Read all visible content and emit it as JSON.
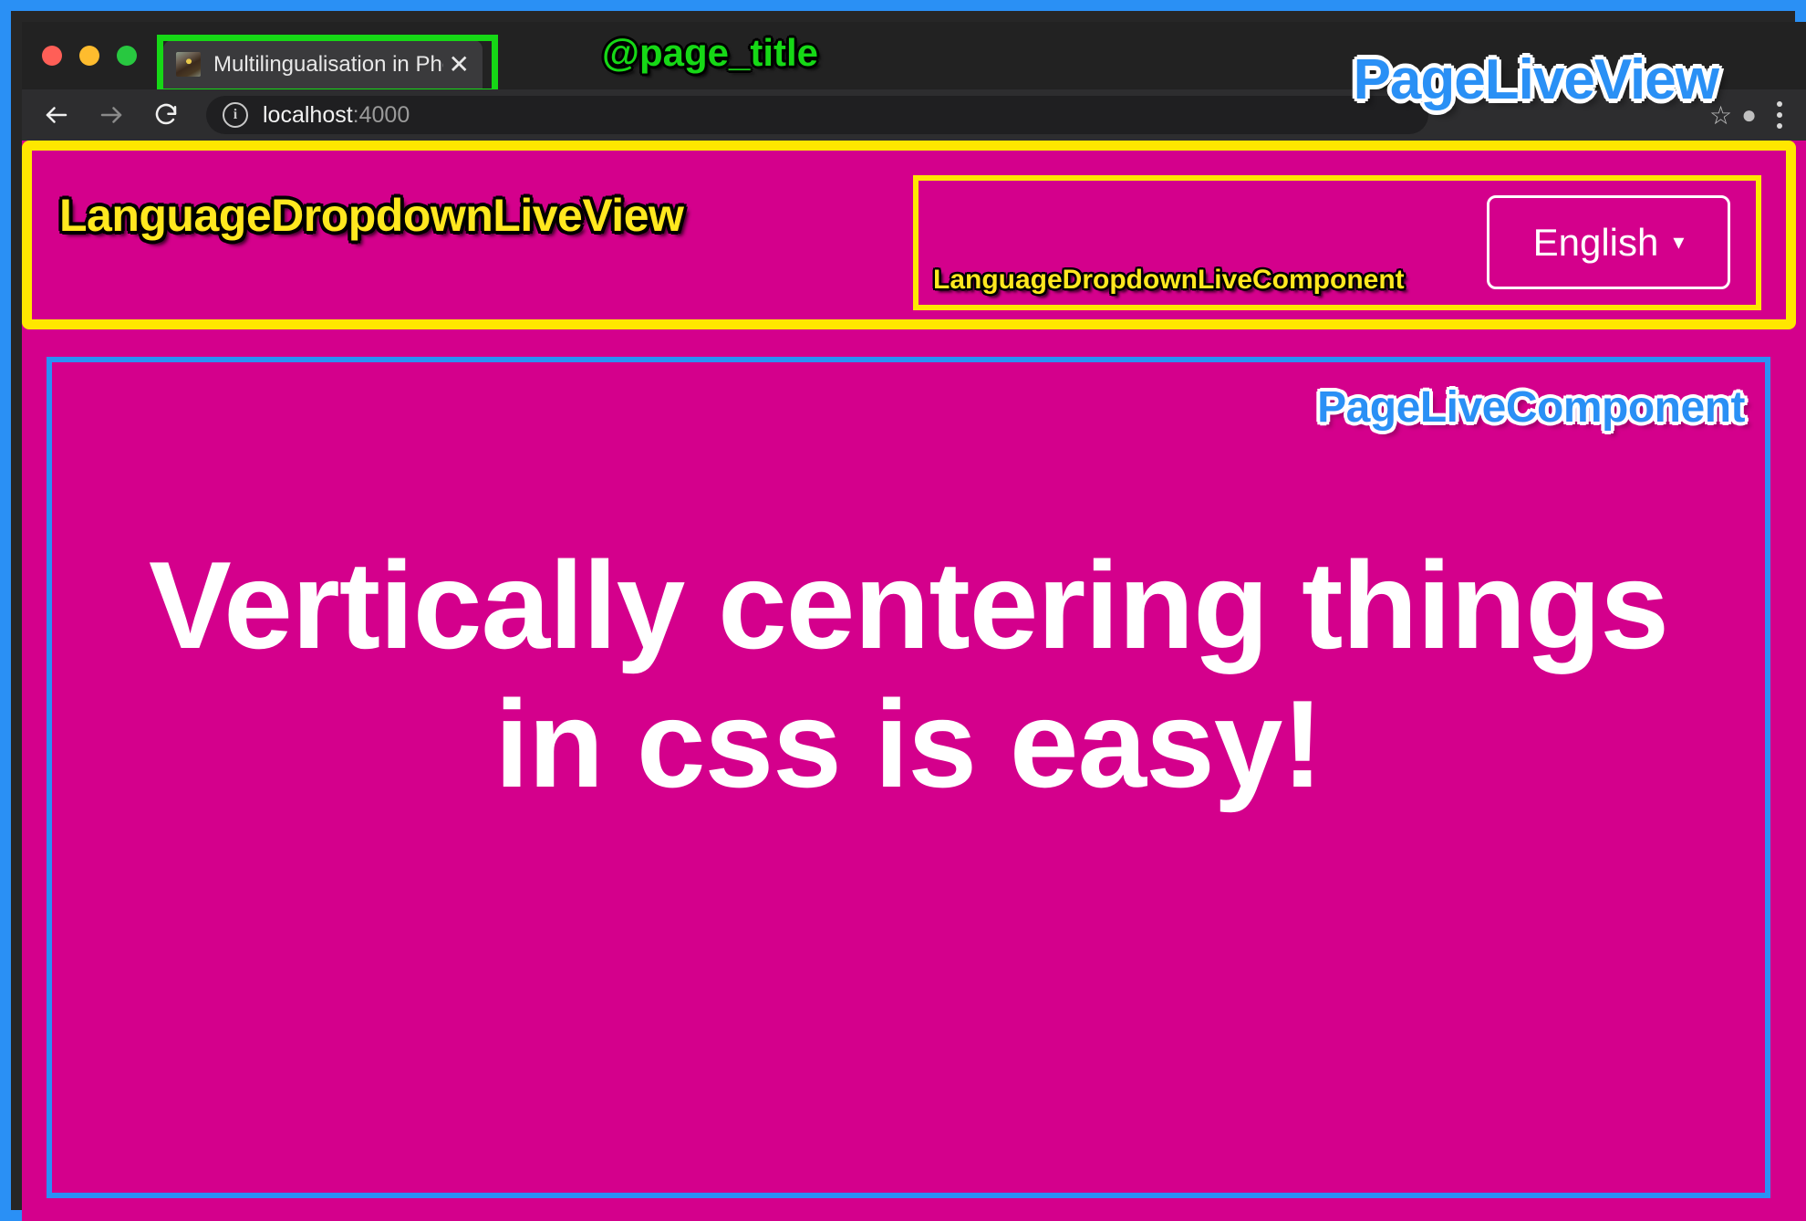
{
  "browser": {
    "traffic_lights": [
      "close",
      "minimize",
      "maximize"
    ],
    "tab": {
      "title": "Multilingualisation in Phoenix",
      "close_label": "✕",
      "favicon": "site-favicon"
    },
    "toolbar": {
      "back_icon": "back-arrow-icon",
      "forward_icon": "forward-arrow-icon",
      "reload_icon": "reload-icon",
      "info_icon": "ⓘ",
      "url_host": "localhost",
      "url_port": ":4000",
      "star_icon": "☆",
      "profile_icon": "●",
      "menu_icon": "kebab-menu-icon"
    }
  },
  "annotations": {
    "page_title": "@page_title",
    "page_liveview": "PageLiveView",
    "language_dropdown_liveview": "LanguageDropdownLiveView",
    "language_dropdown_livecomponent": "LanguageDropdownLiveComponent",
    "page_livecomponent": "PageLiveComponent"
  },
  "language_dropdown": {
    "selected": "English",
    "caret": "▾",
    "options": [
      "English"
    ]
  },
  "main": {
    "heading_line_1": "Vertically centering things",
    "heading_line_2": "in css is easy!"
  },
  "colors": {
    "page_background": "#d4008c",
    "outer_frame_blue": "#2a90f5",
    "annotation_yellow": "#ffe700",
    "annotation_green": "#16d816",
    "heading_white": "#ffffff",
    "chrome_dark": "#262626"
  }
}
